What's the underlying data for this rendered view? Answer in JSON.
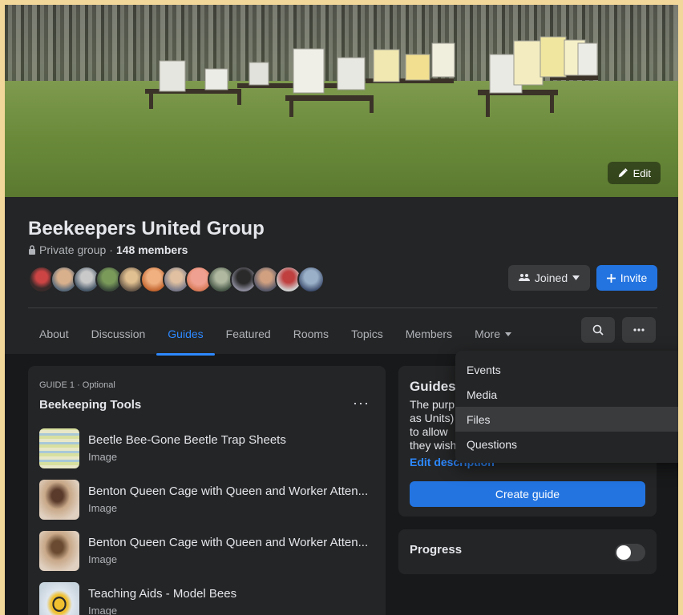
{
  "cover": {
    "edit_label": "Edit"
  },
  "group": {
    "name": "Beekeepers United Group",
    "privacy": "Private group",
    "separator": "·",
    "members": "148 members"
  },
  "actions": {
    "joined_label": "Joined",
    "invite_label": "Invite"
  },
  "tabs": [
    {
      "label": "About"
    },
    {
      "label": "Discussion"
    },
    {
      "label": "Guides",
      "active": true
    },
    {
      "label": "Featured"
    },
    {
      "label": "Rooms"
    },
    {
      "label": "Topics"
    },
    {
      "label": "Members"
    },
    {
      "label": "More"
    }
  ],
  "guide": {
    "label": "GUIDE 1 · Optional",
    "title": "Beekeeping Tools",
    "items": [
      {
        "title": "Beetle Bee-Gone Beetle Trap Sheets",
        "type": "Image"
      },
      {
        "title": "Benton Queen Cage with Queen and Worker Atten...",
        "type": "Image"
      },
      {
        "title": "Benton Queen Cage with Queen and Worker Atten...",
        "type": "Image"
      },
      {
        "title": "Teaching Aids - Model Bees",
        "type": "Image"
      }
    ]
  },
  "guides_panel": {
    "title": "Guides",
    "lines": [
      "The purp",
      "as Units)",
      "to allow",
      "they wish"
    ],
    "edit_link": "Edit description",
    "create_label": "Create guide"
  },
  "progress": {
    "label": "Progress",
    "enabled": false
  },
  "more_menu": {
    "items": [
      "Events",
      "Media",
      "Files",
      "Questions"
    ],
    "highlighted": "Files"
  },
  "colors": {
    "accent": "#2d88ff",
    "button_primary": "#2374e1",
    "surface": "#242526",
    "background": "#18191a",
    "page_border": "#f2d79a"
  }
}
